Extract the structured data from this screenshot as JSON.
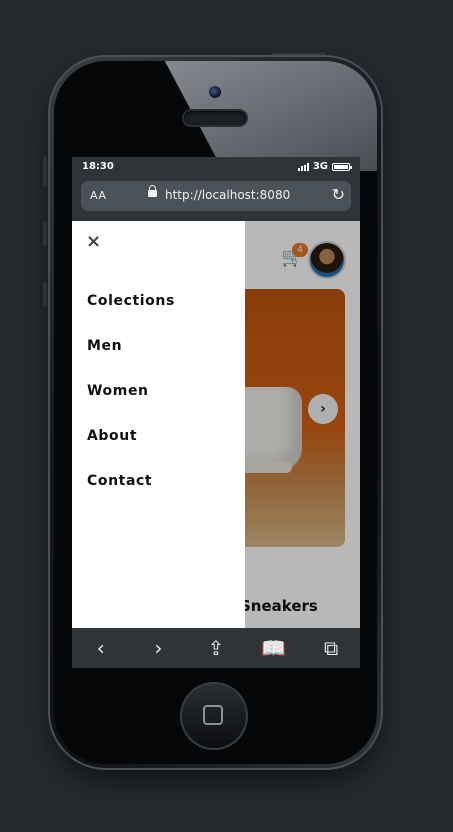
{
  "status_bar": {
    "time": "18:30",
    "network": "3G"
  },
  "browser": {
    "text_size_label": "AA",
    "url": "http://localhost:8080"
  },
  "header": {
    "cart_count": "4"
  },
  "drawer": {
    "close_label": "×",
    "items": [
      {
        "label": "Colections"
      },
      {
        "label": "Men"
      },
      {
        "label": "Women"
      },
      {
        "label": "About"
      },
      {
        "label": "Contact"
      }
    ]
  },
  "hero": {
    "next_label": "›"
  },
  "content": {
    "title_fragment": "Sneakers"
  },
  "toolbar": {
    "back": "‹",
    "forward": "›",
    "share": "⇪",
    "bookmarks": "📖",
    "tabs": "⧉"
  },
  "colors": {
    "accent": "#e4782b",
    "chrome": "#2f3438"
  }
}
